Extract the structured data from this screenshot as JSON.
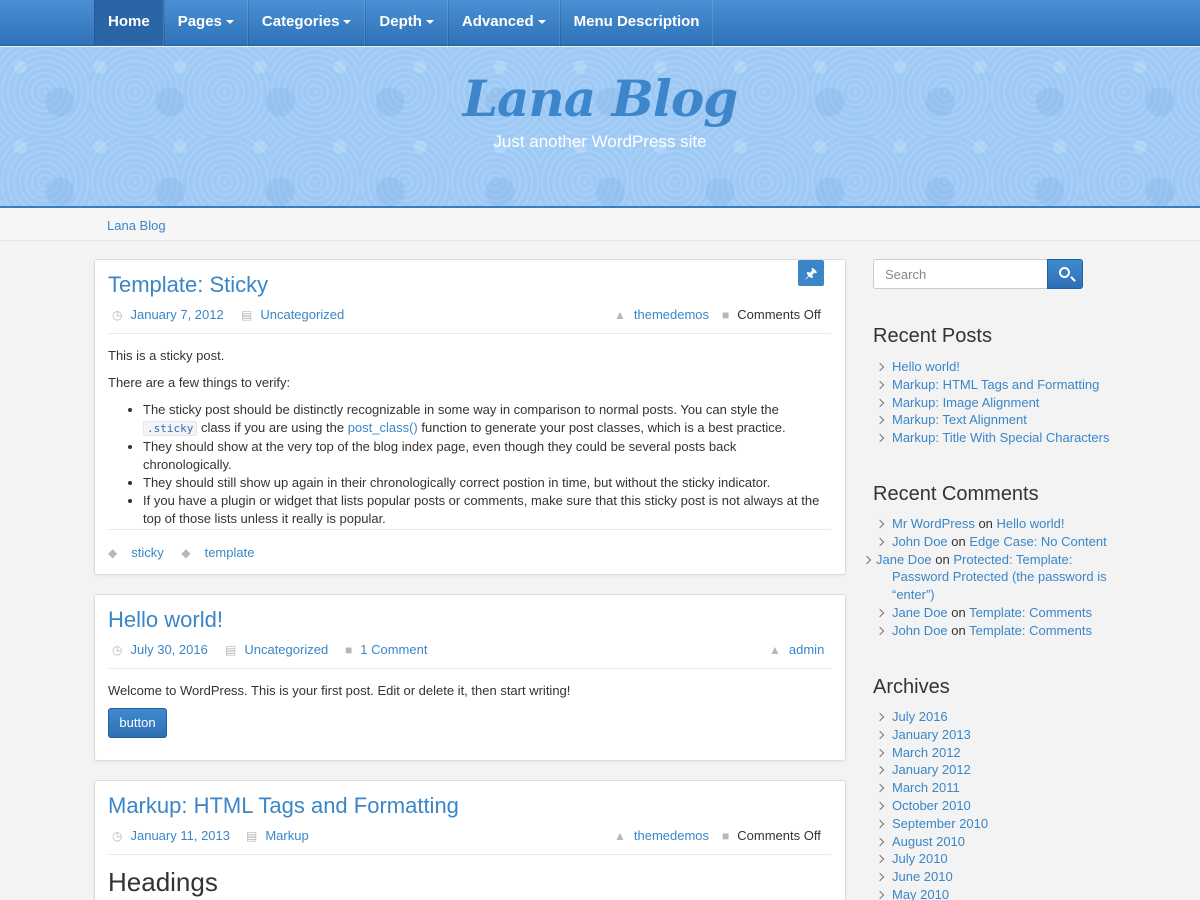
{
  "nav": {
    "items": [
      {
        "label": "Home",
        "caret": false,
        "active": true
      },
      {
        "label": "Pages",
        "caret": true
      },
      {
        "label": "Categories",
        "caret": true
      },
      {
        "label": "Depth",
        "caret": true
      },
      {
        "label": "Advanced",
        "caret": true
      },
      {
        "label": "Menu Description",
        "caret": false
      }
    ]
  },
  "header": {
    "title": "Lana Blog",
    "description": "Just another WordPress site"
  },
  "breadcrumb": {
    "home": "Lana Blog"
  },
  "posts": [
    {
      "title": "Template: Sticky",
      "date": "January 7, 2012",
      "category": "Uncategorized",
      "author": "themedemos",
      "comments": "Comments Off",
      "intro": "This is a sticky post.",
      "intro2": "There are a few things to verify:",
      "bullets": {
        "b1_pre": "The sticky post should be distinctly recognizable in some way in comparison to normal posts. You can style the",
        "b1_code": ".sticky",
        "b1_mid": "class if you are using the",
        "b1_link": "post_class()",
        "b1_post": "function to generate your post classes, which is a best practice.",
        "b2": "They should show at the very top of the blog index page, even though they could be several posts back chronologically.",
        "b3": "They should still show up again in their chronologically correct postion in time, but without the sticky indicator.",
        "b4": "If you have a plugin or widget that lists popular posts or comments, make sure that this sticky post is not always at the top of those lists unless it really is popular."
      },
      "tags": [
        "sticky",
        "template"
      ]
    },
    {
      "title": "Hello world!",
      "date": "July 30, 2016",
      "category": "Uncategorized",
      "comments": "1 Comment",
      "author": "admin",
      "excerpt": "Welcome to WordPress. This is your first post. Edit or delete it, then start writing!",
      "button": "button"
    },
    {
      "title": "Markup: HTML Tags and Formatting",
      "date": "January 11, 2013",
      "category": "Markup",
      "author": "themedemos",
      "comments": "Comments Off",
      "heading": "Headings"
    }
  ],
  "sidebar": {
    "search": {
      "placeholder": "Search"
    },
    "recent_posts": {
      "title": "Recent Posts",
      "items": [
        "Hello world!",
        "Markup: HTML Tags and Formatting",
        "Markup: Image Alignment",
        "Markup: Text Alignment",
        "Markup: Title With Special Characters"
      ]
    },
    "recent_comments": {
      "title": "Recent Comments",
      "on": "on",
      "items": [
        {
          "author": "Mr WordPress",
          "post": "Hello world!"
        },
        {
          "author": "John Doe",
          "post": "Edge Case: No Content"
        },
        {
          "author": "Jane Doe",
          "post": "Protected: Template: Password Protected (the password is “enter”)"
        },
        {
          "author": "Jane Doe",
          "post": "Template: Comments"
        },
        {
          "author": "John Doe",
          "post": "Template: Comments"
        }
      ]
    },
    "archives": {
      "title": "Archives",
      "items": [
        "July 2016",
        "January 2013",
        "March 2012",
        "January 2012",
        "March 2011",
        "October 2010",
        "September 2010",
        "August 2010",
        "July 2010",
        "June 2010",
        "May 2010"
      ]
    }
  },
  "colors": {
    "accent": "#3a86c8",
    "nav": "#2f72b8",
    "header_bg": "#9ec9f5"
  }
}
